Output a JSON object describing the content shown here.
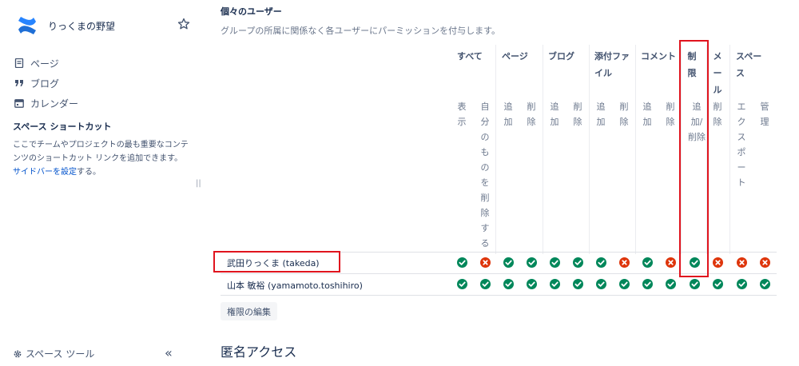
{
  "sidebar": {
    "space_name": "りっくまの野望",
    "nav": [
      {
        "label": "ページ",
        "icon": "page-icon"
      },
      {
        "label": "ブログ",
        "icon": "quote-icon"
      },
      {
        "label": "カレンダー",
        "icon": "calendar-icon"
      }
    ],
    "shortcut_title": "スペース ショートカット",
    "shortcut_desc_1": "ここでチームやプロジェクトの最も重要なコンテンツのショートカット リンクを追加できます。",
    "shortcut_link": "サイドバーを設定",
    "shortcut_desc_2": "する。",
    "resize_handle": "||",
    "space_tools": "スペース ツール",
    "collapse": "«"
  },
  "main": {
    "section_title": "個々のユーザー",
    "section_desc": "グループの所属に関係なく各ユーザーにパーミッションを付与します。",
    "categories": [
      "すべて",
      "ページ",
      "ブログ",
      "添付ファイル",
      "コメント",
      "制限",
      "メール",
      "スペース"
    ],
    "sub_headers": [
      "表示",
      "自分のものを削除する",
      "追加",
      "削除",
      "追加",
      "削除",
      "追加",
      "削除",
      "追加",
      "削除",
      "追加/削除",
      "削除",
      "エクスポート",
      "管理"
    ],
    "users": [
      {
        "name": "武田りっくま (takeda)",
        "perms": [
          true,
          false,
          true,
          true,
          true,
          true,
          true,
          false,
          true,
          false,
          true,
          false,
          false,
          false
        ]
      },
      {
        "name": "山本 敏裕 (yamamoto.toshihiro)",
        "perms": [
          true,
          true,
          true,
          true,
          true,
          true,
          true,
          true,
          true,
          true,
          true,
          true,
          true,
          true
        ]
      }
    ],
    "edit_button": "権限の編集",
    "anon_title": "匿名アクセス"
  },
  "colors": {
    "allowed": "#00875a",
    "denied": "#de350b",
    "highlight": "#e0141e",
    "link": "#0052cc"
  }
}
